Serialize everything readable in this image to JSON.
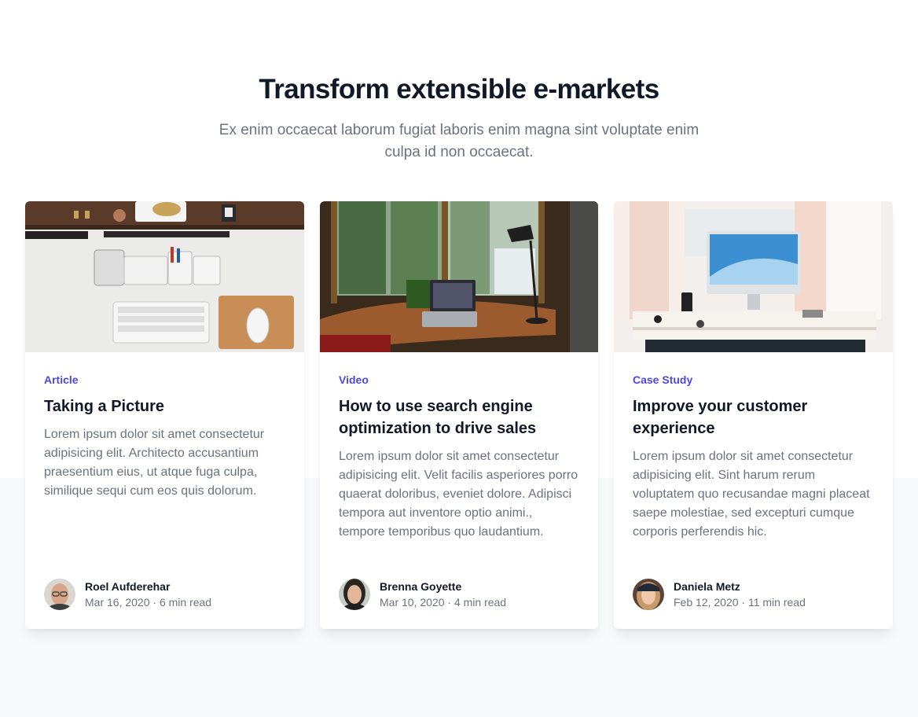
{
  "header": {
    "title": "Transform extensible e-markets",
    "subtitle": "Ex enim occaecat laborum fugiat laboris enim magna sint voluptate enim culpa id non occaecat."
  },
  "cards": [
    {
      "category": "Article",
      "title": "Taking a Picture",
      "description": "Lorem ipsum dolor sit amet consectetur adipisicing elit. Architecto accusantium praesentium eius, ut atque fuga culpa, similique sequi cum eos quis dolorum.",
      "author": "Roel Aufderehar",
      "date": "Mar 16, 2020",
      "separator": "·",
      "read_time": "6 min read"
    },
    {
      "category": "Video",
      "title": "How to use search engine optimization to drive sales",
      "description": "Lorem ipsum dolor sit amet consectetur adipisicing elit. Velit facilis asperiores porro quaerat doloribus, eveniet dolore. Adipisci tempora aut inventore optio animi., tempore temporibus quo laudantium.",
      "author": "Brenna Goyette",
      "date": "Mar 10, 2020",
      "separator": "·",
      "read_time": "4 min read"
    },
    {
      "category": "Case Study",
      "title": "Improve your customer experience",
      "description": "Lorem ipsum dolor sit amet consectetur adipisicing elit. Sint harum rerum voluptatem quo recusandae magni placeat saepe molestiae, sed excepturi cumque corporis perferendis hic.",
      "author": "Daniela Metz",
      "date": "Feb 12, 2020",
      "separator": "·",
      "read_time": "11 min read"
    }
  ],
  "colors": {
    "accent": "#4f46e5",
    "heading": "#111827",
    "muted": "#6b7280",
    "band": "#f8f9fb"
  }
}
